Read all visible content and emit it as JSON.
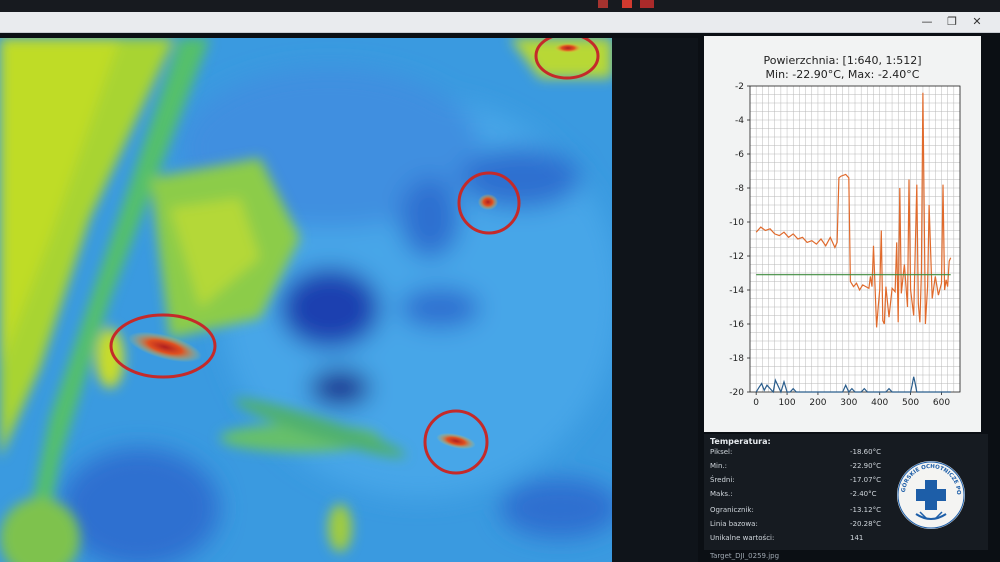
{
  "window": {
    "minimize_label": "—",
    "maximize_label": "❐",
    "close_label": "✕"
  },
  "chart_data": {
    "type": "line",
    "title_line1": "Powierzchnia: [1:640, 1:512]",
    "title_line2": "Min: -22.90°C, Max: -2.40°C",
    "xlim": [
      -20,
      660
    ],
    "ylim": [
      -20,
      -2
    ],
    "x_ticks": [
      0,
      100,
      200,
      300,
      400,
      500,
      600
    ],
    "y_ticks": [
      -20,
      -18,
      -16,
      -14,
      -12,
      -10,
      -8,
      -6,
      -4,
      -2
    ],
    "grid": true,
    "series": [
      {
        "color": "#e06a2c",
        "x": [
          0,
          15,
          30,
          45,
          60,
          75,
          90,
          105,
          120,
          135,
          150,
          165,
          180,
          195,
          210,
          225,
          240,
          255,
          262,
          268,
          275,
          290,
          300,
          305,
          315,
          325,
          335,
          345,
          355,
          365,
          370,
          375,
          380,
          385,
          390,
          395,
          400,
          405,
          410,
          415,
          420,
          430,
          440,
          450,
          455,
          460,
          465,
          470,
          480,
          490,
          495,
          500,
          510,
          520,
          525,
          530,
          535,
          540,
          548,
          555,
          560,
          570,
          580,
          590,
          600,
          605,
          610,
          615,
          620,
          625,
          630
        ],
        "y": [
          -10.6,
          -10.3,
          -10.5,
          -10.4,
          -10.7,
          -10.8,
          -10.6,
          -10.9,
          -10.7,
          -11.0,
          -10.9,
          -11.2,
          -11.1,
          -11.3,
          -11.0,
          -11.4,
          -10.9,
          -11.5,
          -11.2,
          -7.4,
          -7.3,
          -7.2,
          -7.4,
          -13.5,
          -13.8,
          -13.6,
          -14.0,
          -13.7,
          -13.8,
          -13.9,
          -13.2,
          -13.8,
          -11.4,
          -13.9,
          -16.2,
          -15.0,
          -14.0,
          -10.5,
          -15.8,
          -16.0,
          -13.8,
          -15.6,
          -13.9,
          -14.1,
          -11.2,
          -15.9,
          -8.0,
          -14.2,
          -12.5,
          -15.0,
          -7.5,
          -14.0,
          -15.5,
          -7.8,
          -14.8,
          -15.9,
          -13.0,
          -2.4,
          -16.0,
          -13.8,
          -9.0,
          -14.5,
          -13.2,
          -14.3,
          -13.6,
          -7.8,
          -14.0,
          -13.4,
          -13.8,
          -12.3,
          -12.1
        ]
      },
      {
        "color": "#3f8c3f",
        "x": [
          0,
          630
        ],
        "y": [
          -13.1,
          -13.1
        ]
      },
      {
        "color": "#2a5d8c",
        "x": [
          0,
          10,
          18,
          26,
          35,
          45,
          55,
          62,
          70,
          80,
          90,
          100,
          110,
          120,
          130,
          140,
          150,
          160,
          170,
          180,
          190,
          200,
          210,
          220,
          230,
          240,
          250,
          260,
          270,
          280,
          290,
          300,
          310,
          320,
          330,
          340,
          350,
          360,
          370,
          380,
          390,
          400,
          410,
          420,
          430,
          440,
          450,
          460,
          470,
          480,
          490,
          500,
          505,
          510,
          515,
          520,
          525,
          530,
          540,
          550,
          560,
          570,
          580,
          590,
          600,
          610,
          620,
          630
        ],
        "y": [
          -20.0,
          -19.7,
          -19.5,
          -19.9,
          -19.6,
          -19.8,
          -20.0,
          -19.3,
          -19.6,
          -20.0,
          -19.4,
          -20.0,
          -20.0,
          -19.8,
          -20.0,
          -20.0,
          -20.0,
          -20.0,
          -20.0,
          -20.0,
          -20.0,
          -20.0,
          -20.0,
          -20.0,
          -20.0,
          -20.0,
          -20.0,
          -20.0,
          -20.0,
          -20.0,
          -19.6,
          -20.0,
          -19.8,
          -20.0,
          -20.0,
          -20.0,
          -19.8,
          -20.0,
          -20.0,
          -20.0,
          -20.0,
          -20.0,
          -20.0,
          -20.0,
          -19.8,
          -20.0,
          -20.0,
          -20.0,
          -20.0,
          -20.0,
          -20.0,
          -20.0,
          -19.6,
          -19.1,
          -19.5,
          -20.0,
          -20.0,
          -20.0,
          -20.0,
          -20.0,
          -20.0,
          -20.0,
          -20.0,
          -20.0,
          -20.0,
          -20.0,
          -20.0,
          -20.0
        ]
      }
    ]
  },
  "stats": {
    "header": "Temperatura:",
    "rows": [
      {
        "label": "Piksel:",
        "value": "-18.60°C"
      },
      {
        "label": "Min.:",
        "value": "-22.90°C"
      },
      {
        "label": "Średni:",
        "value": "-17.07°C"
      },
      {
        "label": "Maks.:",
        "value": "-2.40°C"
      },
      {
        "label": "Ogranicznik:",
        "value": "-13.12°C"
      },
      {
        "label": "Linia bazowa:",
        "value": "-20.28°C"
      },
      {
        "label": "Unikalne wartości:",
        "value": "141"
      }
    ]
  },
  "filename": "Target_DJI_0259.jpg",
  "badge": {
    "text": "GÓRSKIE OCHOTNICZE POGOTOWIE RATUNKOWE",
    "color": "#1d5ea8"
  },
  "detections": [
    {
      "name": "hotspot-top"
    },
    {
      "name": "hotspot-upper-right"
    },
    {
      "name": "hotspot-left"
    },
    {
      "name": "hotspot-bottom"
    }
  ]
}
